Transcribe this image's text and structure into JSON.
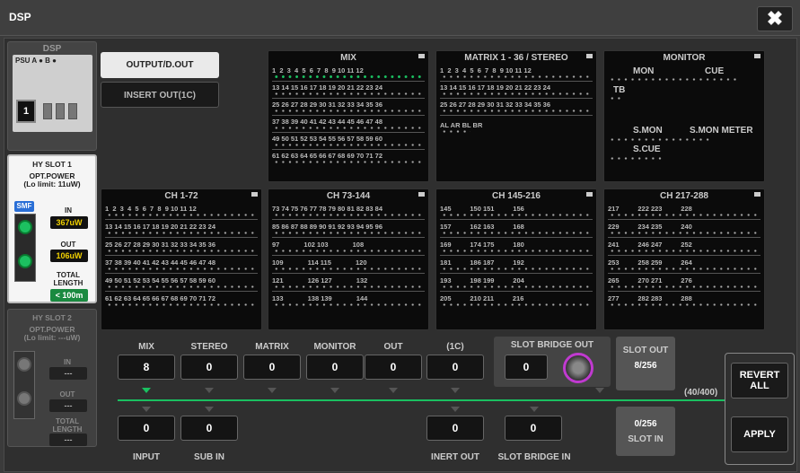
{
  "window": {
    "title": "DSP",
    "close": "✖"
  },
  "dsp": {
    "title": "DSP",
    "psu": "PSU A ● B ●",
    "card": "1"
  },
  "slot1": {
    "title": "HY SLOT 1",
    "power_label": "OPT.POWER",
    "power_limit": "(Lo limit: 11uW)",
    "type": "SMF",
    "in_label": "IN",
    "in_value": "367uW",
    "out_label": "OUT",
    "out_value": "106uW",
    "total_label": "TOTAL",
    "length_label": "LENGTH",
    "length_value": "< 100m"
  },
  "slot2": {
    "title": "HY SLOT 2",
    "power_label": "OPT.POWER",
    "power_limit": "(Lo limit: ---uW)",
    "in_label": "IN",
    "in_value": "---",
    "out_label": "OUT",
    "out_value": "---",
    "total_label": "TOTAL",
    "length_label": "LENGTH",
    "length_value": "---"
  },
  "tabs": {
    "output": "OUTPUT/D.OUT",
    "insert": "INSERT OUT(1C)"
  },
  "blocks": {
    "mix": {
      "title": "MIX",
      "rows": [
        "1  2  3  4  5  6  7  8  9 10 11 12",
        "13 14 15 16 17 18 19 20 21 22 23 24",
        "25 26 27 28 29 30 31 32 33 34 35 36",
        "37 38 39 40 41 42 43 44 45 46 47 48",
        "49 50 51 52 53 54 55 56 57 58 59 60",
        "61 62 63 64 65 66 67 68 69 70 71 72"
      ]
    },
    "matrix": {
      "title": "MATRIX 1 - 36 / STEREO",
      "rows": [
        "1  2  3  4  5  6  7  8  9 10 11 12",
        "13 14 15 16 17 18 19 20 21 22 23 24",
        "25 26 27 28 29 30 31 32 33 34 35 36",
        "AL AR BL BR"
      ]
    },
    "monitor": {
      "title": "MONITOR",
      "mon": "MON",
      "cue": "CUE",
      "tb": "TB",
      "smon": "S.MON",
      "smonmeter": "S.MON METER",
      "scue": "S.CUE"
    },
    "ch1": {
      "title": "CH 1-72",
      "rows": [
        "1  2  3  4  5  6  7  8  9 10 11 12",
        "13 14 15 16 17 18 19 20 21 22 23 24",
        "25 26 27 28 29 30 31 32 33 34 35 36",
        "37 38 39 40 41 42 43 44 45 46 47 48",
        "49 50 51 52 53 54 55 56 57 58 59 60",
        "61 62 63 64 65 66 67 68 69 70 71 72"
      ]
    },
    "ch2": {
      "title": "CH 73-144",
      "rows": [
        "73 74 75 76 77 78 79 80 81 82 83 84",
        "85 86 87 88 89 90 91 92 93 94 95 96",
        "97             102 103             108",
        "109             114 115             120",
        "121             126 127             132",
        "133             138 139             144"
      ]
    },
    "ch3": {
      "title": "CH 145-216",
      "rows": [
        "145          150 151          156",
        "157          162 163          168",
        "169          174 175          180",
        "181          186 187          192",
        "193          198 199          204",
        "205          210 211          216"
      ]
    },
    "ch4": {
      "title": "CH 217-288",
      "rows": [
        "217          222 223          228",
        "229          234 235          240",
        "241          246 247          252",
        "253          258 259          264",
        "265          270 271          276",
        "277          282 283          288"
      ]
    }
  },
  "outputs": {
    "labels": [
      "MIX",
      "STEREO",
      "MATRIX",
      "MONITOR",
      "OUT",
      "(1C)"
    ],
    "values": [
      "8",
      "0",
      "0",
      "0",
      "0",
      "0"
    ],
    "sbo_label": "SLOT BRIDGE OUT",
    "sbo_value": "0"
  },
  "inputs": {
    "labels": [
      "INPUT",
      "SUB IN",
      "INERT OUT",
      "SLOT BRIDGE IN"
    ],
    "values": [
      "0",
      "0",
      "0",
      "0"
    ]
  },
  "slot_out": {
    "label": "SLOT OUT",
    "value": "8/256"
  },
  "slot_in": {
    "label": "SLOT IN",
    "value": "0/256"
  },
  "total": "(40/400)",
  "buttons": {
    "revert": "REVERT ALL",
    "apply": "APPLY"
  }
}
